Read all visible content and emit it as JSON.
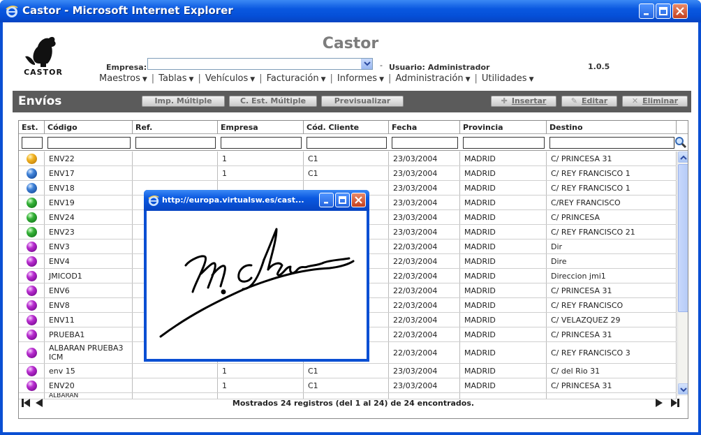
{
  "window": {
    "title": "Castor - Microsoft Internet Explorer"
  },
  "header": {
    "app_title": "Castor",
    "logo_text": "CASTOR",
    "empresa_label": "Empresa:",
    "empresa_value": "",
    "dash": "-",
    "user_label": "Usuario: Administrador",
    "version": "1.0.5"
  },
  "menu": [
    {
      "label": "Maestros"
    },
    {
      "label": "Tablas"
    },
    {
      "label": "Vehículos"
    },
    {
      "label": "Facturación"
    },
    {
      "label": "Informes"
    },
    {
      "label": "Administración"
    },
    {
      "label": "Utilidades"
    }
  ],
  "section": {
    "title": "Envíos",
    "buttons": {
      "imp_multiple": "Imp. Múltiple",
      "est_multiple": "C. Est. Múltiple",
      "previsualizar": "Previsualizar",
      "insertar": "Insertar",
      "editar": "Editar",
      "eliminar": "Eliminar"
    }
  },
  "grid": {
    "columns": [
      "Est.",
      "Código",
      "Ref.",
      "Empresa",
      "Cód. Cliente",
      "Fecha",
      "Provincia",
      "Destino"
    ],
    "rows": [
      {
        "status": "orange",
        "codigo": "ENV22",
        "ref": "",
        "empresa": "1",
        "cliente": "C1",
        "fecha": "23/03/2004",
        "provincia": "MADRID",
        "destino": "C/ PRINCESA 31"
      },
      {
        "status": "blue",
        "codigo": "ENV17",
        "ref": "",
        "empresa": "1",
        "cliente": "C1",
        "fecha": "23/03/2004",
        "provincia": "MADRID",
        "destino": "C/ REY FRANCISCO 1"
      },
      {
        "status": "blue",
        "codigo": "ENV18",
        "ref": "",
        "empresa": "",
        "cliente": "",
        "fecha": "23/03/2004",
        "provincia": "MADRID",
        "destino": "C/ REY FRANCISCO 1"
      },
      {
        "status": "green",
        "codigo": "ENV19",
        "ref": "",
        "empresa": "",
        "cliente": "",
        "fecha": "23/03/2004",
        "provincia": "MADRID",
        "destino": "C/REY FRANCISCO"
      },
      {
        "status": "green",
        "codigo": "ENV24",
        "ref": "",
        "empresa": "",
        "cliente": "",
        "fecha": "23/03/2004",
        "provincia": "MADRID",
        "destino": "C/ PRINCESA"
      },
      {
        "status": "green",
        "codigo": "ENV23",
        "ref": "",
        "empresa": "",
        "cliente": "",
        "fecha": "23/03/2004",
        "provincia": "MADRID",
        "destino": "C/ REY FRANCISCO 21"
      },
      {
        "status": "purple",
        "codigo": "ENV3",
        "ref": "",
        "empresa": "",
        "cliente": "",
        "fecha": "22/03/2004",
        "provincia": "MADRID",
        "destino": "Dir"
      },
      {
        "status": "purple",
        "codigo": "ENV4",
        "ref": "",
        "empresa": "",
        "cliente": "",
        "fecha": "22/03/2004",
        "provincia": "MADRID",
        "destino": "Dire"
      },
      {
        "status": "purple",
        "codigo": "JMICOD1",
        "ref": "",
        "empresa": "",
        "cliente": "",
        "fecha": "22/03/2004",
        "provincia": "MADRID",
        "destino": "Direccion jmi1"
      },
      {
        "status": "purple",
        "codigo": "ENV6",
        "ref": "",
        "empresa": "",
        "cliente": "",
        "fecha": "22/03/2004",
        "provincia": "MADRID",
        "destino": "C/ PRINCESA 31"
      },
      {
        "status": "purple",
        "codigo": "ENV8",
        "ref": "",
        "empresa": "",
        "cliente": "",
        "fecha": "22/03/2004",
        "provincia": "MADRID",
        "destino": "C/ REY FRANCISCO"
      },
      {
        "status": "purple",
        "codigo": "ENV11",
        "ref": "",
        "empresa": "",
        "cliente": "",
        "fecha": "22/03/2004",
        "provincia": "MADRID",
        "destino": "C/ VELAZQUEZ 29"
      },
      {
        "status": "purple",
        "codigo": "PRUEBA1",
        "ref": "",
        "empresa": "",
        "cliente": "",
        "fecha": "22/03/2004",
        "provincia": "MADRID",
        "destino": "C/ PRINCESA 31"
      },
      {
        "status": "purple",
        "codigo": "ALBARAN PRUEBA3 ICM",
        "ref": "",
        "empresa": "",
        "cliente": "",
        "fecha": "22/03/2004",
        "provincia": "MADRID",
        "destino": "C/ REY FRANCISCO 3",
        "tall": true
      },
      {
        "status": "purple",
        "codigo": "env 15",
        "ref": "",
        "empresa": "1",
        "cliente": "C1",
        "fecha": "23/03/2004",
        "provincia": "MADRID",
        "destino": "C/ del Rio 31"
      },
      {
        "status": "purple",
        "codigo": "ENV20",
        "ref": "",
        "empresa": "1",
        "cliente": "C1",
        "fecha": "23/03/2004",
        "provincia": "MADRID",
        "destino": "C/ PRINCESA 31"
      },
      {
        "status": "purple",
        "codigo": "ALBARAN",
        "ref": "",
        "empresa": "",
        "cliente": "",
        "fecha": "",
        "provincia": "",
        "destino": "",
        "partial": true
      }
    ],
    "footer": "Mostrados 24 registros (del 1 al 24) de 24 encontrados."
  },
  "popup": {
    "title": "http://europa.virtualsw.es/cast..."
  }
}
